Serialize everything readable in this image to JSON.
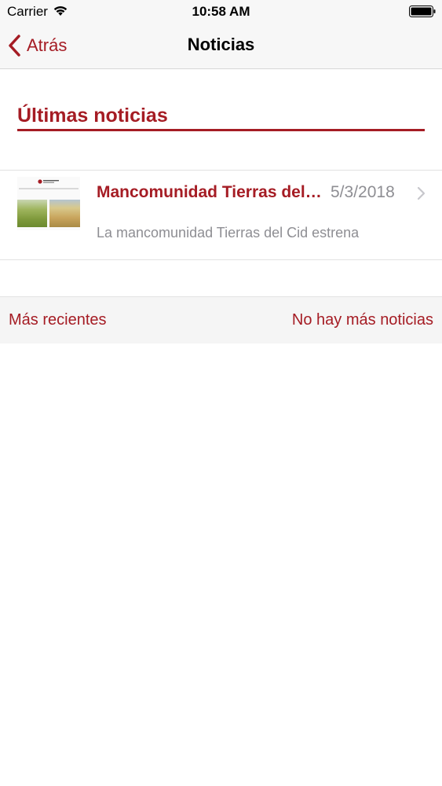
{
  "status_bar": {
    "carrier": "Carrier",
    "time": "10:58 AM",
    "icons": [
      "wifi-icon",
      "battery-icon"
    ]
  },
  "nav": {
    "back_label": "Atrás",
    "title": "Noticias"
  },
  "section": {
    "title": "Últimas noticias"
  },
  "news": [
    {
      "title": "Mancomunidad Tierras del Cid estrena",
      "date": "5/3/2018",
      "summary": "La mancomunidad Tierras del Cid estrena"
    }
  ],
  "pager": {
    "recent_label": "Más recientes",
    "no_more_label": "No hay más noticias"
  },
  "colors": {
    "accent": "#a51c24",
    "secondary_text": "#8e8e93",
    "bar_background": "#f7f7f7"
  }
}
